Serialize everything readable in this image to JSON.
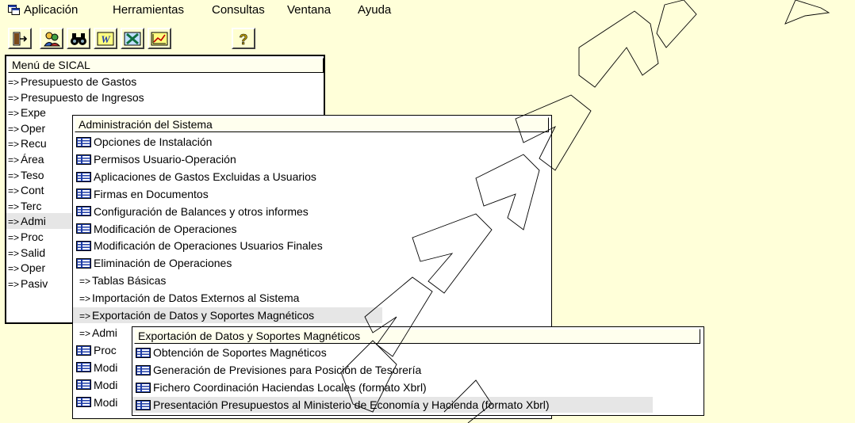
{
  "menubar": {
    "items": [
      "Aplicación",
      "Herramientas",
      "Consultas",
      "Ventana",
      "Ayuda"
    ]
  },
  "toolbar": {
    "buttons": [
      "exit-icon",
      "users-icon",
      "binoculars-icon",
      "word-icon",
      "excel-icon",
      "chart-icon",
      "help-icon"
    ]
  },
  "main_menu": {
    "title": "Menú de SICAL",
    "items": [
      "Presupuesto de Gastos",
      "Presupuesto de Ingresos",
      "Expe",
      "Oper",
      "Recu",
      "Área",
      "Teso",
      "Cont",
      "Terc",
      "Admi",
      "Proc",
      "Salid",
      "Oper",
      "Pasiv"
    ]
  },
  "admin_menu": {
    "title": "Administración del Sistema",
    "items": [
      {
        "label": "Opciones de Instalación",
        "icon": "form-icon"
      },
      {
        "label": "Permisos Usuario-Operación",
        "icon": "form-icon"
      },
      {
        "label": "Aplicaciones de Gastos Excluidas a Usuarios",
        "icon": "form-icon"
      },
      {
        "label": "Firmas en Documentos",
        "icon": "form-icon"
      },
      {
        "label": "Configuración de Balances y otros informes",
        "icon": "form-icon"
      },
      {
        "label": "Modificación de Operaciones",
        "icon": "form-icon"
      },
      {
        "label": "Modificación de Operaciones Usuarios Finales",
        "icon": "form-icon"
      },
      {
        "label": "Eliminación de Operaciones",
        "icon": "form-icon"
      },
      {
        "label": "Tablas Básicas",
        "icon": "arrow"
      },
      {
        "label": "Importación de Datos Externos al Sistema",
        "icon": "arrow"
      },
      {
        "label": "Exportación de Datos y Soportes Magnéticos",
        "icon": "arrow"
      },
      {
        "label": "Admi",
        "icon": "arrow"
      },
      {
        "label": "Proc",
        "icon": "form-icon"
      },
      {
        "label": "Modi",
        "icon": "form-icon"
      },
      {
        "label": "Modi",
        "icon": "form-icon"
      },
      {
        "label": "Modi",
        "icon": "form-icon"
      }
    ]
  },
  "export_menu": {
    "title": "Exportación de Datos y Soportes Magnéticos",
    "items": [
      "Obtención  de Soportes Magnéticos",
      "Generación de Previsiones para Posición de Tesorería",
      "Fichero Coordinación Haciendas Locales (formato Xbrl)",
      "Presentación Presupuestos al Ministerio de Economía y Hacienda (formato Xbrl)"
    ]
  },
  "arrow_glyph": "=>",
  "colors": {
    "background": "#ffffd9",
    "selection": "#e6e6e6",
    "form_icon_blue": "#1f3ea8"
  }
}
